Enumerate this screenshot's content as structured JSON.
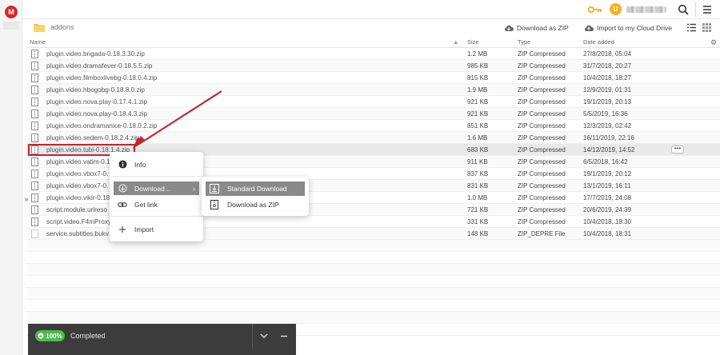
{
  "app": {
    "logo_letter": "M",
    "user_initial": "U"
  },
  "toolbar": {
    "breadcrumb": "addons",
    "download_zip_label": "Download as ZIP",
    "import_label": "Import to my Cloud Drive"
  },
  "table": {
    "headers": {
      "name": "Name",
      "size": "Size",
      "type": "Type",
      "date": "Date added"
    },
    "rows": [
      {
        "name": "plugin.video.brigada-0.18.3.30.zip",
        "size": "1.2 MB",
        "type": "ZIP Compressed",
        "date": "27/8/2018, 05:04"
      },
      {
        "name": "plugin.video.dramafever-0.18.5.5.zip",
        "size": "985 KB",
        "type": "ZIP Compressed",
        "date": "31/7/2018, 20:27"
      },
      {
        "name": "plugin.video.filmboxlivebg-0.18.0.4.zip",
        "size": "815 KB",
        "type": "ZIP Compressed",
        "date": "10/4/2018, 18:27"
      },
      {
        "name": "plugin.video.hbogobg-0.18.8.0.zip",
        "size": "1.9 MB",
        "type": "ZIP Compressed",
        "date": "12/9/2019, 01:31"
      },
      {
        "name": "plugin.video.nova.play-0.17.4.1.zip",
        "size": "921 KB",
        "type": "ZIP Compressed",
        "date": "19/1/2019, 20:13"
      },
      {
        "name": "plugin.video.nova.play-0.18.4.3.zip",
        "size": "921 KB",
        "type": "ZIP Compressed",
        "date": "5/5/2019, 16:36"
      },
      {
        "name": "plugin.video.ondramanice-0.18.0.2.zip",
        "size": "851 KB",
        "type": "ZIP Compressed",
        "date": "12/3/2019, 02:42"
      },
      {
        "name": "plugin.video.sedem-0.18.2.4.zip",
        "size": "1.6 MB",
        "type": "ZIP Compressed",
        "date": "16/11/2019, 22:16"
      },
      {
        "name": "plugin.video.tubi-0.18.1.4.zip",
        "size": "683 KB",
        "type": "ZIP Compressed",
        "date": "14/12/2019, 14:52"
      },
      {
        "name": "plugin.video.vatim-0.1",
        "size": "911 KB",
        "type": "ZIP Compressed",
        "date": "6/5/2018, 16:42"
      },
      {
        "name": "plugin.video.vbox7-0.",
        "size": "837 KB",
        "type": "ZIP Compressed",
        "date": "19/1/2019, 20:12"
      },
      {
        "name": "plugin.video.vbox7-0.",
        "size": "831 KB",
        "type": "ZIP Compressed",
        "date": "13/1/2019, 16:11"
      },
      {
        "name": "plugin.video.vikir-0.18",
        "size": "1.0 MB",
        "type": "ZIP Compressed",
        "date": "17/7/2019, 24:08"
      },
      {
        "name": "script.module.urlreso",
        "size": "721 KB",
        "type": "ZIP Compressed",
        "date": "20/6/2019, 24:39"
      },
      {
        "name": "script.video.F4mProxy",
        "size": "331 KB",
        "type": "ZIP Compressed",
        "date": "10/4/2018, 18:30"
      },
      {
        "name": "service.subtitles.bukv",
        "size": "148 KB",
        "type": "ZIP_DEPRE File",
        "date": "10/4/2018, 18:31"
      }
    ],
    "more_label": "•••"
  },
  "context_menu": {
    "info": "Info",
    "download": "Download...",
    "get_link": "Get link",
    "import": "Import"
  },
  "submenu": {
    "standard": "Standard Download",
    "zip": "Download as ZIP"
  },
  "transfer": {
    "progress": "100%",
    "progress_value": 100,
    "status": "Completed"
  },
  "colors": {
    "highlight": "#c0272d",
    "progress": "#4eb84e",
    "avatar": "#f3b21b",
    "logo": "#d9272e"
  }
}
